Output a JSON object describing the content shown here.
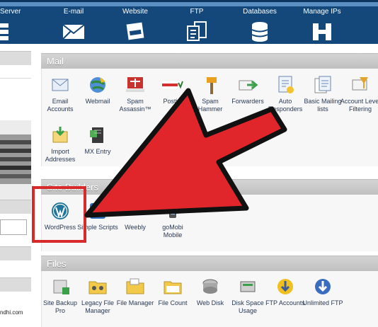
{
  "topnav": {
    "items": [
      {
        "label": "Server",
        "icon": "server-icon"
      },
      {
        "label": "E-mail",
        "icon": "envelope-icon"
      },
      {
        "label": "Website",
        "icon": "website-icon"
      },
      {
        "label": "FTP",
        "icon": "ftp-icon"
      },
      {
        "label": "Databases",
        "icon": "database-icon"
      },
      {
        "label": "Manage IPs",
        "icon": "manage-ips-icon"
      }
    ]
  },
  "left": {
    "footer_text": "ndhi.com"
  },
  "mail": {
    "title": "Mail",
    "items": [
      {
        "label": "Email Accounts",
        "icon": "email-accounts-icon"
      },
      {
        "label": "Webmail",
        "icon": "webmail-icon"
      },
      {
        "label": "Spam Assassin™",
        "icon": "spamassassin-icon"
      },
      {
        "label": "Postini",
        "icon": "postini-icon"
      },
      {
        "label": "Spam Hammer",
        "icon": "spam-hammer-icon"
      },
      {
        "label": "Forwarders",
        "icon": "forwarders-icon"
      },
      {
        "label": "Auto Responders",
        "icon": "auto-responders-icon"
      },
      {
        "label": "Basic Mailing lists",
        "icon": "mailing-lists-icon"
      },
      {
        "label": "Account Level Filtering",
        "icon": "filtering-icon"
      },
      {
        "label": "Import Addresses",
        "icon": "import-addresses-icon"
      },
      {
        "label": "MX Entry",
        "icon": "mx-entry-icon"
      }
    ]
  },
  "site_builders": {
    "title": "Site Builders",
    "items": [
      {
        "label": "WordPress",
        "icon": "wordpress-icon"
      },
      {
        "label": "Simple Scripts",
        "icon": "simple-scripts-icon"
      },
      {
        "label": "Weebly",
        "icon": "weebly-icon"
      },
      {
        "label": "goMobi Mobile",
        "icon": "gomobi-icon"
      }
    ]
  },
  "files": {
    "title": "Files",
    "items": [
      {
        "label": "Site Backup Pro",
        "icon": "site-backup-icon"
      },
      {
        "label": "Legacy File Manager",
        "icon": "legacy-file-manager-icon"
      },
      {
        "label": "File Manager",
        "icon": "file-manager-icon"
      },
      {
        "label": "File Count",
        "icon": "file-count-icon"
      },
      {
        "label": "Web Disk",
        "icon": "web-disk-icon"
      },
      {
        "label": "Disk Space Usage",
        "icon": "disk-space-icon"
      },
      {
        "label": "FTP Accounts",
        "icon": "ftp-accounts-icon"
      },
      {
        "label": "Unlimited FTP",
        "icon": "unlimited-ftp-icon"
      }
    ]
  },
  "colors": {
    "nav_bg": "#14487a",
    "section_head": "#c8c8c8",
    "highlight_red": "#d82a2a",
    "arrow_red": "#e0262a"
  }
}
